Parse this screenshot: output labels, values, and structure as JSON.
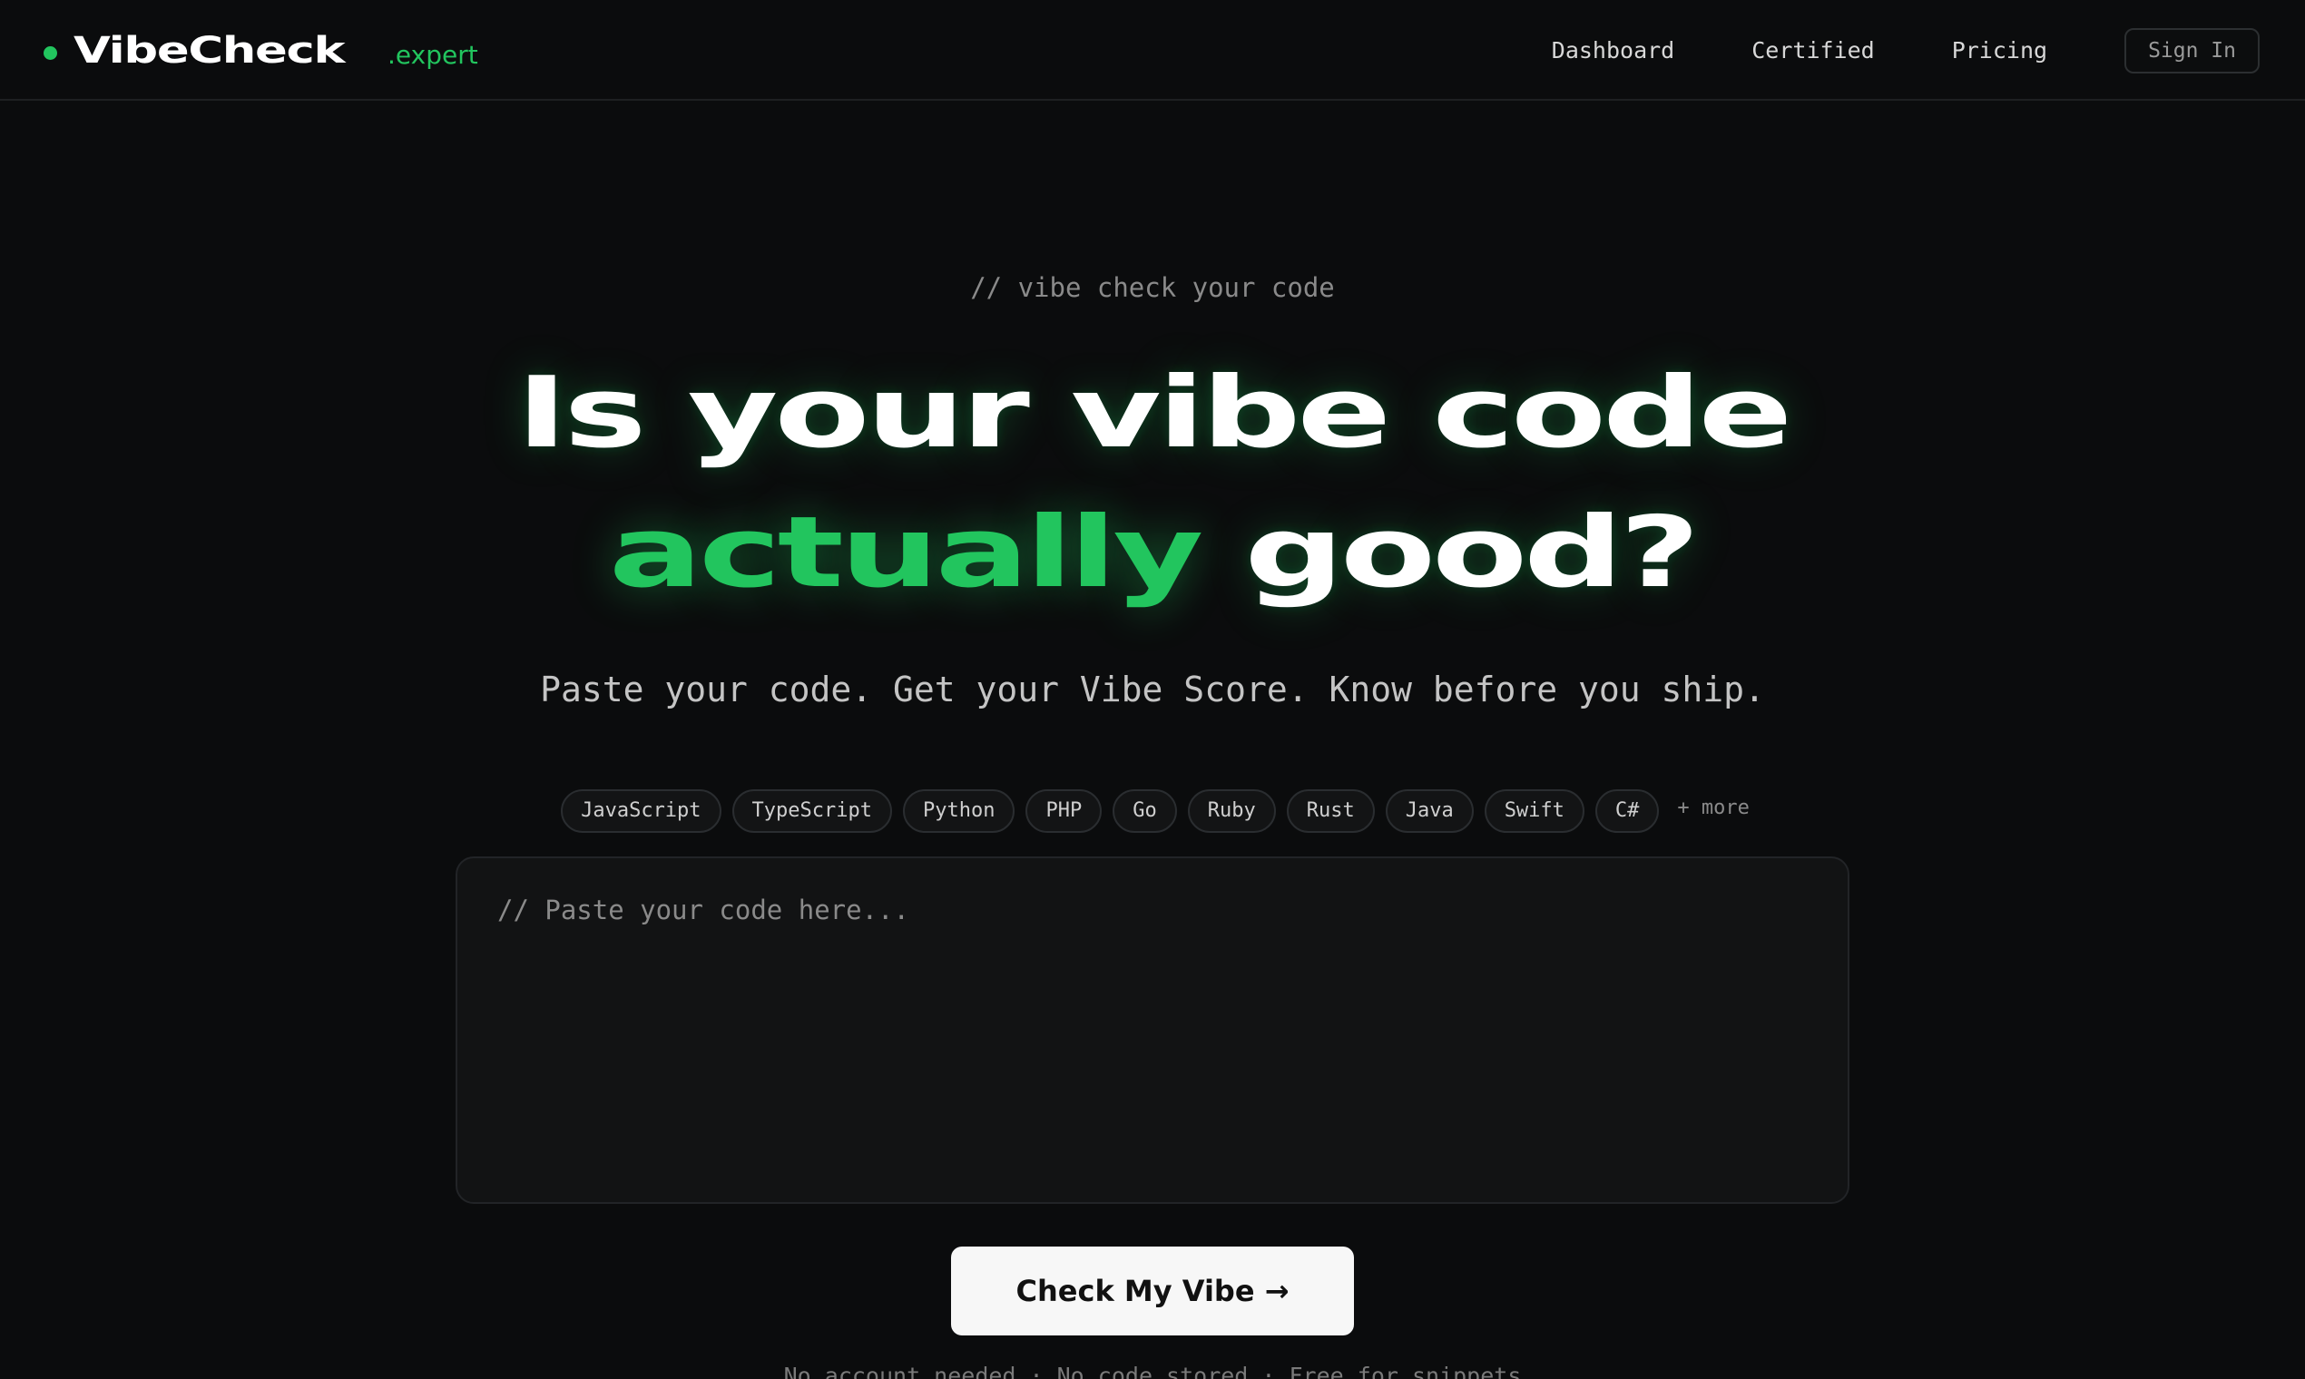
{
  "nav": {
    "brand_name": "VibeCheck",
    "brand_tld": ".expert",
    "links": [
      "Dashboard",
      "Certified",
      "Pricing"
    ],
    "signin_label": "Sign In"
  },
  "hero": {
    "eyebrow": "// vibe check your code",
    "headline_line1": "Is your vibe code",
    "headline_accent": "actually",
    "headline_rest": "good?",
    "tagline": "Paste your code. Get your Vibe Score. Know before you ship."
  },
  "languages": {
    "items": [
      "JavaScript",
      "TypeScript",
      "Python",
      "PHP",
      "Go",
      "Ruby",
      "Rust",
      "Java",
      "Swift",
      "C#"
    ],
    "more_label": "+ more"
  },
  "code_input": {
    "placeholder": "// Paste your code here..."
  },
  "cta": {
    "label": "Check My Vibe →"
  },
  "footnote": "No account needed · No code stored · Free for snippets",
  "colors": {
    "accent": "#22c55e",
    "background": "#0b0c0d",
    "button_bg": "#f7f7f7"
  }
}
